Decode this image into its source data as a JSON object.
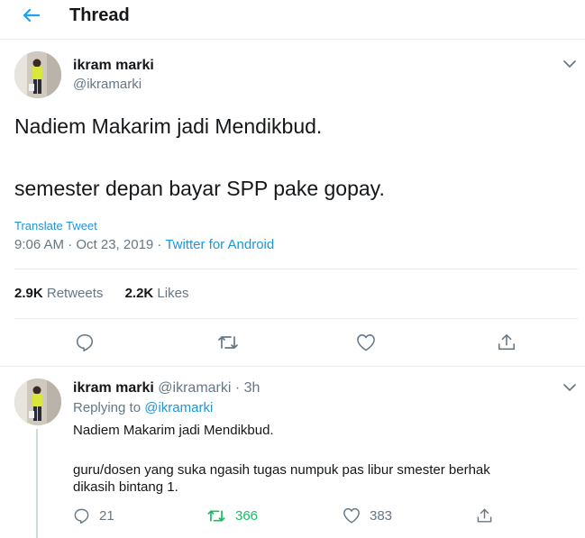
{
  "header": {
    "title": "Thread"
  },
  "main_tweet": {
    "name": "ikram marki",
    "handle": "@ikramarki",
    "text_line1": "Nadiem Makarim jadi Mendikbud.",
    "text_line2": "semester depan bayar SPP pake gopay.",
    "translate_label": "Translate Tweet",
    "timestamp": "9:06 AM · Oct 23, 2019 · ",
    "source": "Twitter for Android",
    "retweets_count": "2.9K",
    "retweets_label": "Retweets",
    "likes_count": "2.2K",
    "likes_label": "Likes"
  },
  "reply_tweet": {
    "name": "ikram marki",
    "handle_time": "@ikramarki · 3h",
    "replying_prefix": "Replying to ",
    "replying_to": "@ikramarki",
    "text_line1": "Nadiem Makarim jadi Mendikbud.",
    "text_line2": "guru/dosen yang suka ngasih tugas numpuk pas libur smester berhak",
    "text_line3": "dikasih bintang 1.",
    "reply_count": "21",
    "retweet_count": "366",
    "like_count": "383"
  },
  "icons": [
    "back-arrow-icon",
    "chevron-down-icon",
    "reply-icon",
    "retweet-icon",
    "like-icon",
    "share-icon"
  ],
  "colors": {
    "accent": "#1b95e0",
    "retweet": "#17bf63",
    "muted": "#657786",
    "divider": "#e6ecf0"
  }
}
